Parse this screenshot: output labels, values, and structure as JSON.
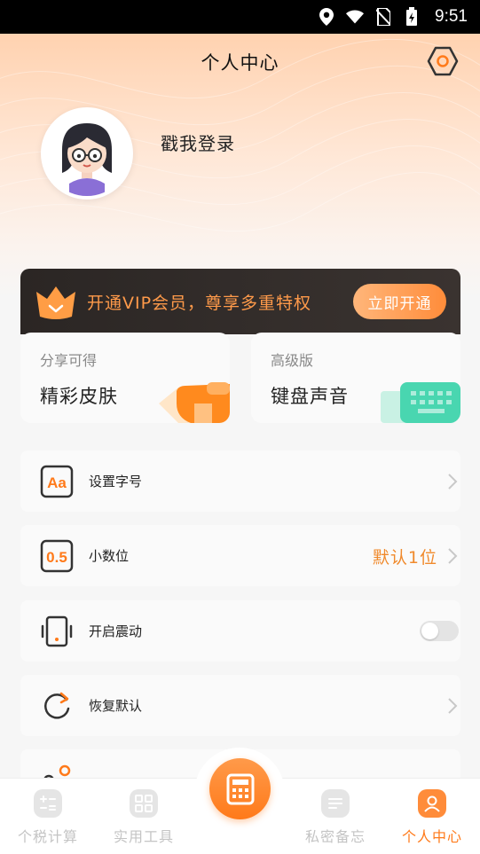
{
  "status_bar": {
    "time": "9:51"
  },
  "header": {
    "title": "个人中心"
  },
  "profile": {
    "login_prompt": "戳我登录"
  },
  "vip": {
    "text": "开通VIP会员，尊享多重特权",
    "button": "立即开通"
  },
  "features": [
    {
      "subtitle": "分享可得",
      "title": "精彩皮肤"
    },
    {
      "subtitle": "高级版",
      "title": "键盘声音"
    }
  ],
  "settings": [
    {
      "label": "设置字号",
      "icon": "font-size-icon"
    },
    {
      "label": "小数位",
      "value": "默认1位",
      "icon": "decimal-icon"
    },
    {
      "label": "开启震动",
      "icon": "vibrate-icon",
      "toggle": false
    },
    {
      "label": "恢复默认",
      "icon": "restore-icon"
    }
  ],
  "tabbar": {
    "items": [
      {
        "label": "个税计算",
        "icon": "calculator-ops-icon"
      },
      {
        "label": "实用工具",
        "icon": "grid-icon"
      },
      {
        "label": "私密备忘",
        "icon": "memo-icon"
      },
      {
        "label": "个人中心",
        "icon": "user-icon",
        "active": true
      }
    ]
  },
  "colors": {
    "accent": "#ff8c3a",
    "vip_text": "#ff9a4a",
    "value_text": "#f08a2c"
  }
}
